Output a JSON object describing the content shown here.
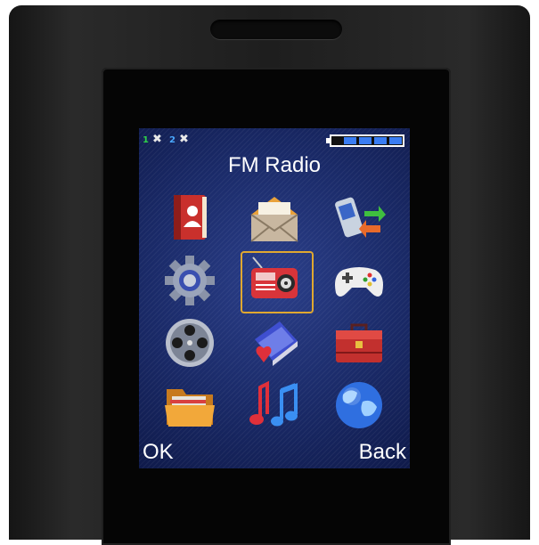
{
  "status_bar": {
    "sim1_label": "1",
    "sim1_icon": "no-signal-x-icon",
    "sim2_label": "2",
    "sim2_icon": "no-signal-x-icon",
    "battery_icon": "battery-full-icon"
  },
  "menu": {
    "title": "FM Radio",
    "selected": "fm-radio",
    "items": [
      {
        "id": "phonebook",
        "icon": "phonebook-icon"
      },
      {
        "id": "messages",
        "icon": "envelope-icon"
      },
      {
        "id": "call-center",
        "icon": "call-log-icon"
      },
      {
        "id": "settings",
        "icon": "gear-icon"
      },
      {
        "id": "fm-radio",
        "icon": "radio-icon"
      },
      {
        "id": "games",
        "icon": "gamepad-icon"
      },
      {
        "id": "multimedia",
        "icon": "film-reel-icon"
      },
      {
        "id": "organizer",
        "icon": "notebook-heart-icon"
      },
      {
        "id": "toolbox",
        "icon": "toolbox-icon"
      },
      {
        "id": "file-manager",
        "icon": "folder-icon"
      },
      {
        "id": "music",
        "icon": "music-notes-icon"
      },
      {
        "id": "internet",
        "icon": "globe-icon"
      }
    ]
  },
  "softkeys": {
    "left": "OK",
    "right": "Back"
  }
}
